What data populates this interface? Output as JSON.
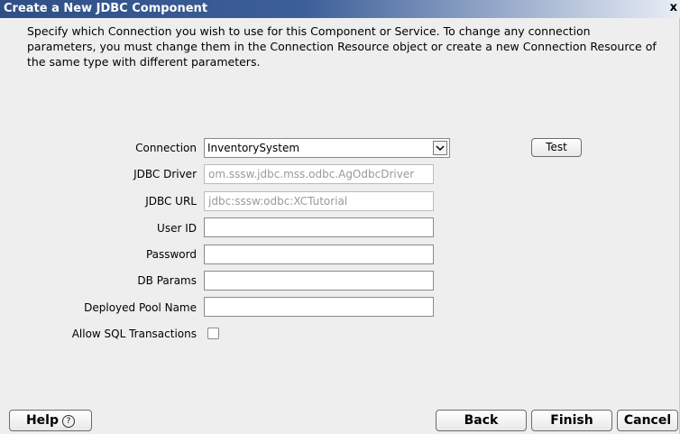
{
  "window": {
    "title": "Create a New JDBC Component",
    "close_label": "x"
  },
  "description": "Specify which Connection you wish to use for this Component or Service.  To change any connection parameters, you must change them in the Connection Resource object or create a new Connection Resource of the same type with different parameters.",
  "form": {
    "connection_label": "Connection",
    "connection_value": "InventorySystem",
    "test_label": "Test",
    "jdbc_driver_label": "JDBC Driver",
    "jdbc_driver_value": "om.sssw.jdbc.mss.odbc.AgOdbcDriver",
    "jdbc_url_label": "JDBC URL",
    "jdbc_url_value": "jdbc:sssw:odbc:XCTutorial",
    "user_id_label": "User ID",
    "user_id_value": "",
    "password_label": "Password",
    "password_value": "",
    "db_params_label": "DB Params",
    "db_params_value": "",
    "pool_name_label": "Deployed Pool Name",
    "pool_name_value": "",
    "allow_sql_label": "Allow SQL Transactions",
    "allow_sql_checked": false
  },
  "footer": {
    "help_label": "Help",
    "back_label": "Back",
    "finish_label": "Finish",
    "cancel_label": "Cancel"
  },
  "icons": {
    "help": "help-circle-icon",
    "dropdown": "chevron-down-icon",
    "close": "close-icon"
  }
}
